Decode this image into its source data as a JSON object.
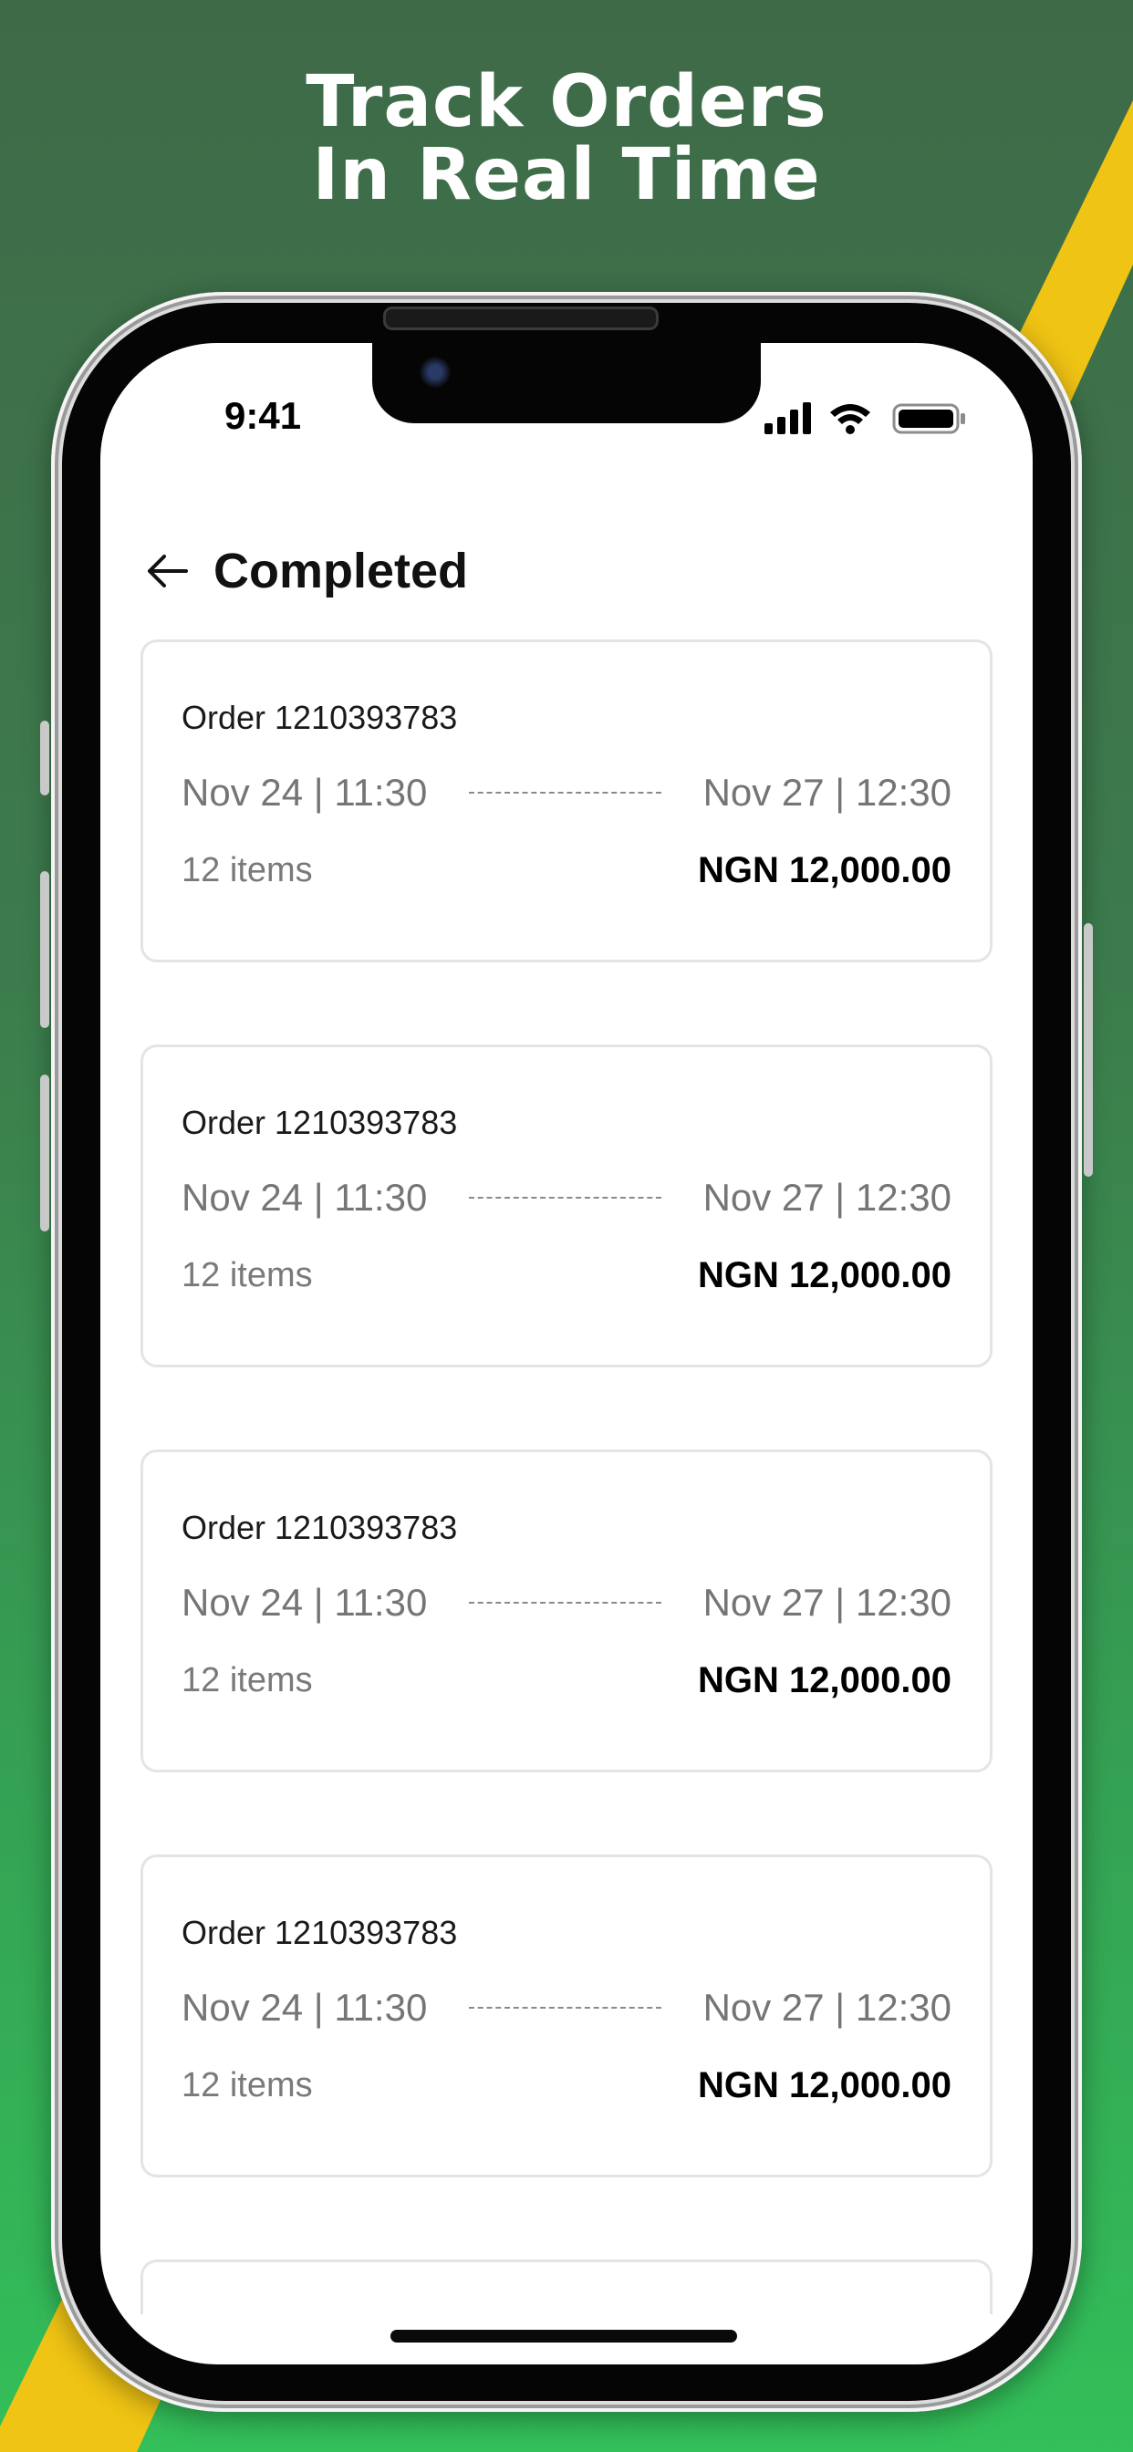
{
  "headline": {
    "line1": "Track Orders",
    "line2": "In Real Time"
  },
  "colors": {
    "brand_green": "#34b157",
    "accent_yellow": "#f0c414",
    "card_border": "#e4e4e4"
  },
  "status_bar": {
    "time": "9:41",
    "icons": [
      "cellular-signal-icon",
      "wifi-icon",
      "battery-icon"
    ]
  },
  "screen": {
    "title": "Completed",
    "back_icon": "arrow-left-icon"
  },
  "orders": [
    {
      "id_label": "Order 1210393783",
      "start": "Nov 24 | 11:30",
      "end": "Nov 27 | 12:30",
      "items": "12 items",
      "price": "NGN 12,000.00"
    },
    {
      "id_label": "Order 1210393783",
      "start": "Nov 24 | 11:30",
      "end": "Nov 27 | 12:30",
      "items": "12 items",
      "price": "NGN 12,000.00"
    },
    {
      "id_label": "Order 1210393783",
      "start": "Nov 24 | 11:30",
      "end": "Nov 27 | 12:30",
      "items": "12 items",
      "price": "NGN 12,000.00"
    },
    {
      "id_label": "Order 1210393783",
      "start": "Nov 24 | 11:30",
      "end": "Nov 27 | 12:30",
      "items": "12 items",
      "price": "NGN 12,000.00"
    }
  ]
}
